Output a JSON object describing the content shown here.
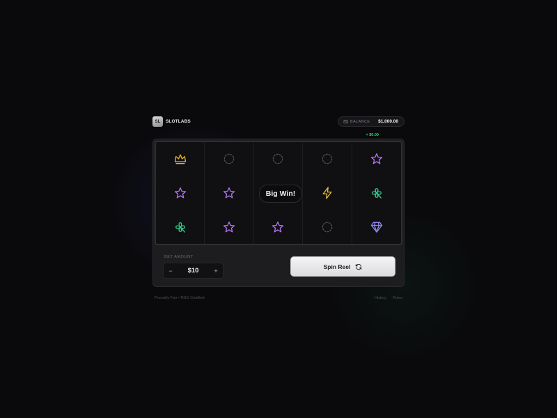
{
  "brand": {
    "logo_text": "SL",
    "name": "SLOTLABS"
  },
  "balance": {
    "label": "BALANCE",
    "value": "$1,000.00",
    "delta": "+ $0.00",
    "icon": "wallet-icon"
  },
  "reels": {
    "rows": [
      [
        "crown",
        "empty",
        "empty",
        "empty",
        "star"
      ],
      [
        "star",
        "star",
        "empty",
        "bolt",
        "clover"
      ],
      [
        "clover",
        "star",
        "star",
        "empty",
        "diamond"
      ]
    ],
    "win_message": "Big Win!"
  },
  "bet": {
    "label": "BET AMOUNT",
    "value": "$10",
    "decrement": "−",
    "increment": "+"
  },
  "spin": {
    "label": "Spin Reel",
    "icon": "refresh-icon"
  },
  "footer": {
    "left_text": "Provably Fair • RNG Certified",
    "links": [
      "History",
      "Rules"
    ]
  },
  "colors": {
    "crown": "#e9b130",
    "star": "#b273f0",
    "clover": "#33c98a",
    "bolt": "#e7c13a",
    "diamond": "#8f86f3",
    "empty": "#4d4d52",
    "positive": "#2fd07a"
  }
}
